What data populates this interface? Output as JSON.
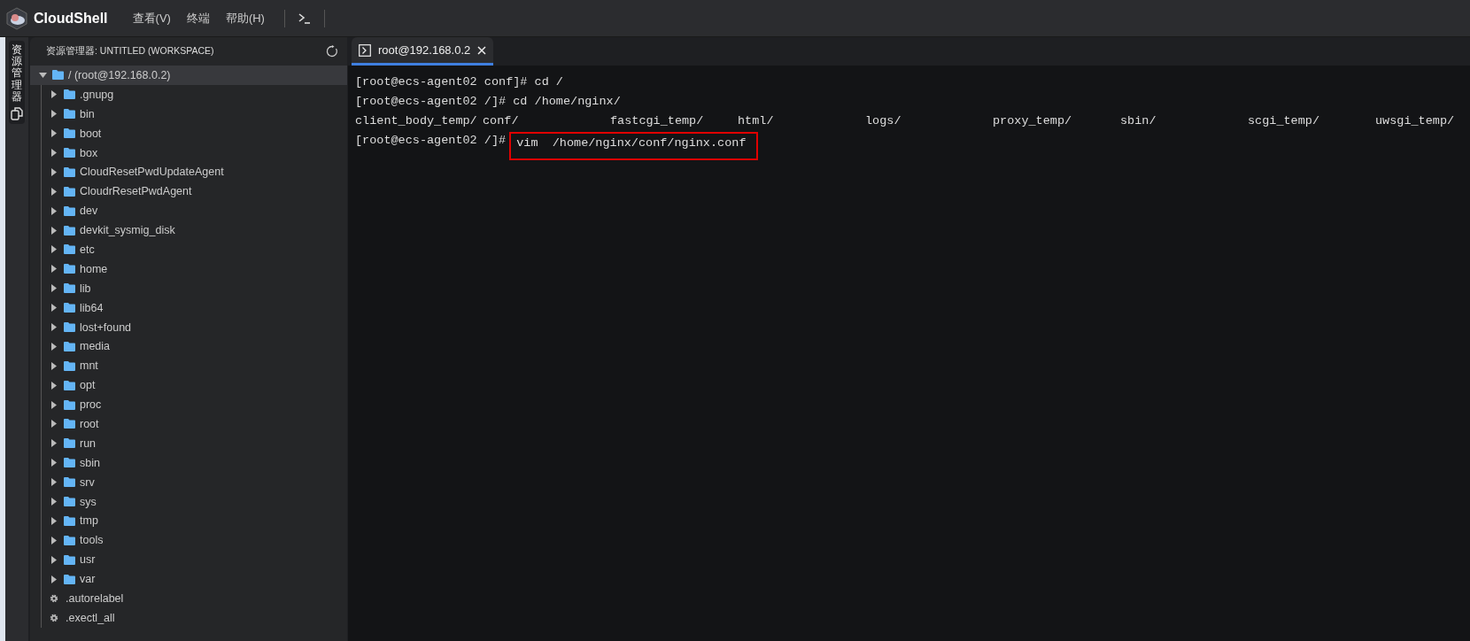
{
  "app": {
    "title": "CloudShell"
  },
  "menu": [
    {
      "label": "查看(V)"
    },
    {
      "label": "终端"
    },
    {
      "label": "帮助(H)"
    }
  ],
  "activity_bar": [
    {
      "label": "资源管理器",
      "selected": true
    }
  ],
  "explorer": {
    "title": "资源管理器: UNTITLED (WORKSPACE)",
    "tree": [
      {
        "label": "/ (root@192.168.0.2)",
        "kind": "folder",
        "expanded": true,
        "selected": true,
        "children": [
          {
            "label": ".gnupg",
            "kind": "folder",
            "expanded": false,
            "selected": false
          },
          {
            "label": "bin",
            "kind": "folder",
            "expanded": false,
            "selected": false
          },
          {
            "label": "boot",
            "kind": "folder",
            "expanded": false,
            "selected": false
          },
          {
            "label": "box",
            "kind": "folder",
            "expanded": false,
            "selected": false
          },
          {
            "label": "CloudResetPwdUpdateAgent",
            "kind": "folder",
            "expanded": false,
            "selected": false
          },
          {
            "label": "CloudrResetPwdAgent",
            "kind": "folder",
            "expanded": false,
            "selected": false
          },
          {
            "label": "dev",
            "kind": "folder",
            "expanded": false,
            "selected": false
          },
          {
            "label": "devkit_sysmig_disk",
            "kind": "folder",
            "expanded": false,
            "selected": false
          },
          {
            "label": "etc",
            "kind": "folder",
            "expanded": false,
            "selected": false
          },
          {
            "label": "home",
            "kind": "folder",
            "expanded": false,
            "selected": false
          },
          {
            "label": "lib",
            "kind": "folder",
            "expanded": false,
            "selected": false
          },
          {
            "label": "lib64",
            "kind": "folder",
            "expanded": false,
            "selected": false
          },
          {
            "label": "lost+found",
            "kind": "folder",
            "expanded": false,
            "selected": false
          },
          {
            "label": "media",
            "kind": "folder",
            "expanded": false,
            "selected": false
          },
          {
            "label": "mnt",
            "kind": "folder",
            "expanded": false,
            "selected": false
          },
          {
            "label": "opt",
            "kind": "folder",
            "expanded": false,
            "selected": false
          },
          {
            "label": "proc",
            "kind": "folder",
            "expanded": false,
            "selected": false
          },
          {
            "label": "root",
            "kind": "folder",
            "expanded": false,
            "selected": false
          },
          {
            "label": "run",
            "kind": "folder",
            "expanded": false,
            "selected": false
          },
          {
            "label": "sbin",
            "kind": "folder",
            "expanded": false,
            "selected": false
          },
          {
            "label": "srv",
            "kind": "folder",
            "expanded": false,
            "selected": false
          },
          {
            "label": "sys",
            "kind": "folder",
            "expanded": false,
            "selected": false
          },
          {
            "label": "tmp",
            "kind": "folder",
            "expanded": false,
            "selected": false
          },
          {
            "label": "tools",
            "kind": "folder",
            "expanded": false,
            "selected": false
          },
          {
            "label": "usr",
            "kind": "folder",
            "expanded": false,
            "selected": false
          },
          {
            "label": "var",
            "kind": "folder",
            "expanded": false,
            "selected": false
          },
          {
            "label": ".autorelabel",
            "kind": "file",
            "selected": false
          },
          {
            "label": ".exectl_all",
            "kind": "file",
            "selected": false
          }
        ]
      }
    ]
  },
  "terminal": {
    "tabs": [
      {
        "label": "root@192.168.0.2",
        "selected": true
      }
    ],
    "lines": [
      {
        "kind": "command",
        "prompt": "[root@ecs-agent02 conf]#",
        "command": "cd /",
        "highlighted": false
      },
      {
        "kind": "command",
        "prompt": "[root@ecs-agent02 /]#",
        "command": "cd /home/nginx/",
        "highlighted": false
      },
      {
        "kind": "listing",
        "entries": [
          "client_body_temp/",
          "conf/",
          "fastcgi_temp/",
          "html/",
          "logs/",
          "proxy_temp/",
          "sbin/",
          "scgi_temp/",
          "uwsgi_temp/"
        ]
      },
      {
        "kind": "command",
        "prompt": "[root@ecs-agent02 /]#",
        "command": "vim  /home/nginx/conf/nginx.conf",
        "highlighted": true
      }
    ]
  }
}
